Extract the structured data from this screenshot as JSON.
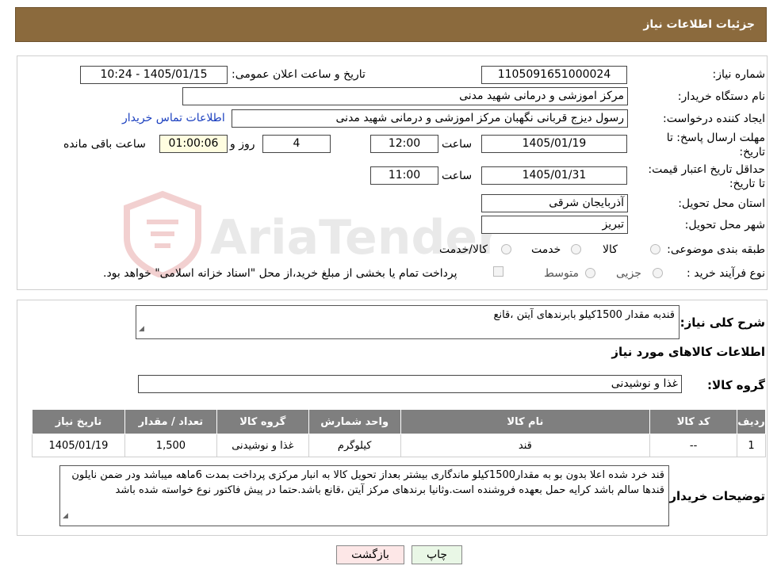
{
  "header": {
    "title": "جزئیات اطلاعات نیاز"
  },
  "form": {
    "need_number_label": "شماره نیاز:",
    "need_number": "1105091651000024",
    "announce_label": "تاریخ و ساعت اعلان عمومی:",
    "announce_value": "1405/01/15 - 10:24",
    "buyer_org_label": "نام دستگاه خریدار:",
    "buyer_org": "مرکز اموزشی و درمانی شهید مدنی",
    "creator_label": "ایجاد کننده درخواست:",
    "creator": "رسول دیزج قربانی نگهبان مرکز اموزشی و درمانی شهید مدنی",
    "contact_link": "اطلاعات تماس خریدار",
    "deadline_label": "مهلت ارسال پاسخ: تا تاریخ:",
    "deadline_date": "1405/01/19",
    "time_label": "ساعت",
    "deadline_time": "12:00",
    "days_value": "4",
    "days_label": "روز و",
    "remaining_value": "01:00:06",
    "remaining_label": "ساعت باقی مانده",
    "validity_label": "حداقل تاریخ اعتبار قیمت: تا تاریخ:",
    "validity_date": "1405/01/31",
    "validity_time": "11:00",
    "province_label": "استان محل تحویل:",
    "province": "آذربایجان شرقی",
    "city_label": "شهر محل تحویل:",
    "city": "تبریز",
    "category_label": "طبقه بندی موضوعی:",
    "category_options": [
      "کالا",
      "خدمت",
      "کالا/خدمت"
    ],
    "process_label": "نوع فرآیند خرید :",
    "process_options": [
      "جزیی",
      "متوسط"
    ],
    "payment_note": "پرداخت تمام یا بخشی از مبلغ خرید،از محل \"اسناد خزانه اسلامی\" خواهد بود."
  },
  "summary": {
    "label": "شرح کلی نیاز:",
    "text": "قندبه مقدار 1500کیلو بابرندهای آیتن ،قانع"
  },
  "goods": {
    "section_title": "اطلاعات کالاهای مورد نیاز",
    "group_label": "گروه کالا:",
    "group_value": "غذا و نوشیدنی"
  },
  "table": {
    "headers": [
      "ردیف",
      "کد کالا",
      "نام کالا",
      "واحد شمارش",
      "گروه کالا",
      "تعداد / مقدار",
      "تاریخ نیاز"
    ],
    "rows": [
      [
        "1",
        "--",
        "قند",
        "کیلوگرم",
        "غذا و نوشیدنی",
        "1,500",
        "1405/01/19"
      ]
    ]
  },
  "buyer_notes": {
    "label": "توضیحات خریدار:",
    "text": "قند خرد شده اعلا بدون بو به مقدار1500کیلو ماندگاری بیشتر بعداز تحویل کالا به انبار مرکزی پرداخت بمدت 6ماهه میباشد ودر ضمن نایلون قندها سالم باشد کرایه حمل بعهده فروشنده است.وثانیا  برندهای مرکز آیتن ،قانع باشد.حتما در پیش فاکتور نوع خواسته شده باشد"
  },
  "buttons": {
    "print": "چاپ",
    "back": "بازگشت"
  },
  "watermark": {
    "text": "AriaTender.neT"
  },
  "colors": {
    "header_bg": "#8b6a3d",
    "table_header_bg": "#7f7f7f",
    "link": "#1a3fbf",
    "back_btn_bg": "#fde7e7",
    "print_btn_bg": "#e9f7e6"
  }
}
